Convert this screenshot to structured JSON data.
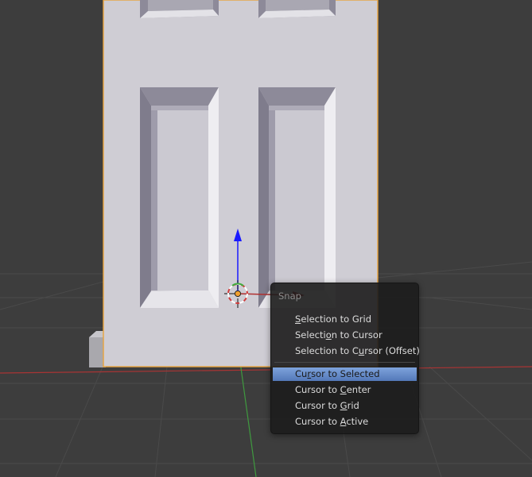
{
  "menu": {
    "title": "Snap",
    "groups": [
      [
        {
          "pre": "",
          "key": "S",
          "post": "election to Grid"
        },
        {
          "pre": "Selecti",
          "key": "o",
          "post": "n to Cursor"
        },
        {
          "pre": "Selection to C",
          "key": "u",
          "post": "rsor (Offset)"
        }
      ],
      [
        {
          "pre": "Cu",
          "key": "r",
          "post": "sor to Selected",
          "active": true
        },
        {
          "pre": "Cursor to ",
          "key": "C",
          "post": "enter"
        },
        {
          "pre": "Cursor to ",
          "key": "G",
          "post": "rid"
        },
        {
          "pre": "Cursor to ",
          "key": "A",
          "post": "ctive"
        }
      ]
    ]
  },
  "colors": {
    "background": "#3d3d3d",
    "door": "#cfcdd4",
    "selection_outline": "#e8a33c",
    "axis_x": "#b03030",
    "axis_y": "#4aa04a",
    "manipulator_z": "#1a1aff",
    "menu_highlight": "#6b8fcc"
  }
}
